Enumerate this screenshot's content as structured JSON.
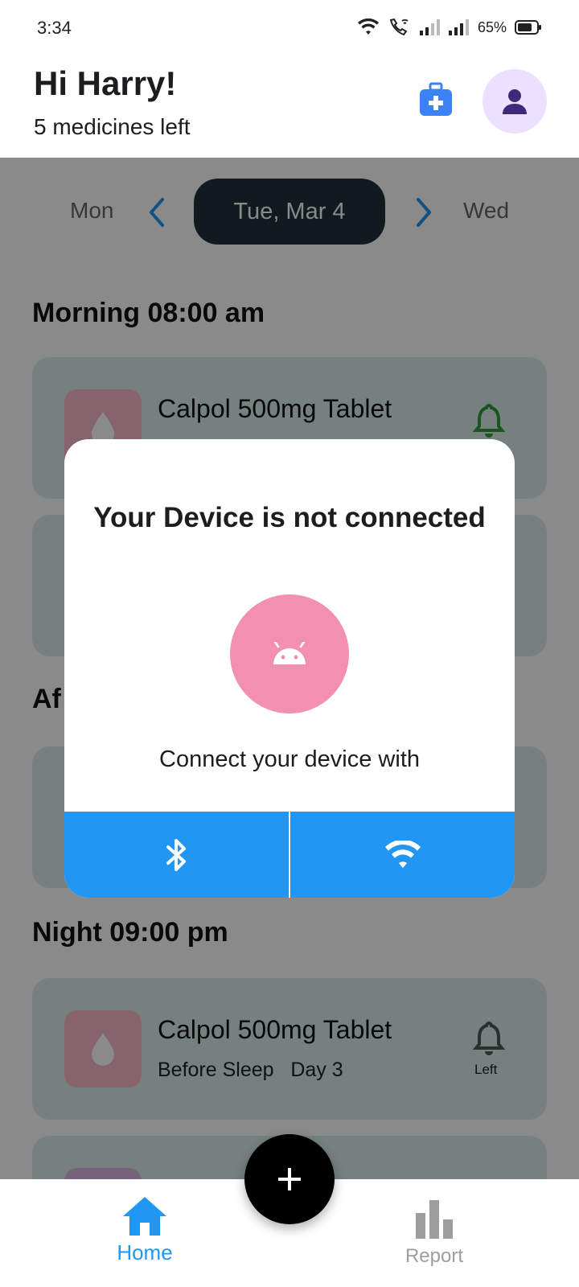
{
  "status_bar": {
    "time": "3:34",
    "battery_percent": "65%",
    "icons": [
      "wifi-icon",
      "wifi-calling-icon",
      "signal-icon",
      "signal-icon",
      "battery-icon"
    ]
  },
  "header": {
    "greeting": "Hi Harry!",
    "subtitle": "5 medicines left",
    "kit_icon": "medical-kit-icon",
    "avatar_icon": "person-icon"
  },
  "day_nav": {
    "prev": "Mon",
    "current": "Tue, Mar 4",
    "next": "Wed"
  },
  "sections": {
    "morning_title": "Morning 08:00 am",
    "afternoon_title_partial": "Af",
    "night_title": "Night 09:00 pm"
  },
  "cards": {
    "morning_1_title": "Calpol 500mg Tablet",
    "night_1_title": "Calpol 500mg Tablet",
    "night_1_sub": "Before Sleep   Day 3",
    "night_1_bell_label": "Left"
  },
  "dialog": {
    "title": "Your Device is not connected",
    "message": "Connect your device with",
    "bluetooth_icon": "bluetooth-icon",
    "wifi_icon": "wifi-icon"
  },
  "bottom_nav": {
    "home_label": "Home",
    "report_label": "Report"
  },
  "colors": {
    "accent": "#2196f3",
    "dark_pill": "#20313a",
    "avatar_bg": "#ece0ff",
    "logo_bg": "#f38fb1",
    "bell_active": "#2e9d3b"
  }
}
